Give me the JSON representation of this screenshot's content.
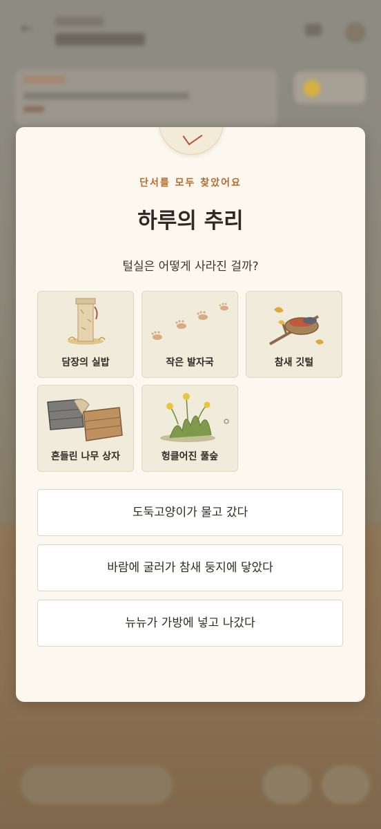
{
  "modal": {
    "eyebrow": "단서를 모두 찾았어요",
    "title": "하루의 추리",
    "question": "털실은 어떻게 사라진 걸까?",
    "clues": [
      {
        "label": "담장의 실밥",
        "icon": "fence-post-icon"
      },
      {
        "label": "작은 발자국",
        "icon": "footprints-icon"
      },
      {
        "label": "참새 깃털",
        "icon": "bird-nest-icon"
      },
      {
        "label": "흔들린 나무 상자",
        "icon": "wooden-crates-icon"
      },
      {
        "label": "헝클어진 풀숲",
        "icon": "grass-bush-icon"
      }
    ],
    "answers": [
      "도둑고양이가 물고 갔다",
      "바람에 굴러가 참새 둥지에 닿았다",
      "뉴뉴가 가방에 넣고 나갔다"
    ]
  },
  "colors": {
    "accent": "#b66a2a",
    "modal_bg": "#fcf8ef",
    "clue_bg": "#f1ebdc"
  }
}
